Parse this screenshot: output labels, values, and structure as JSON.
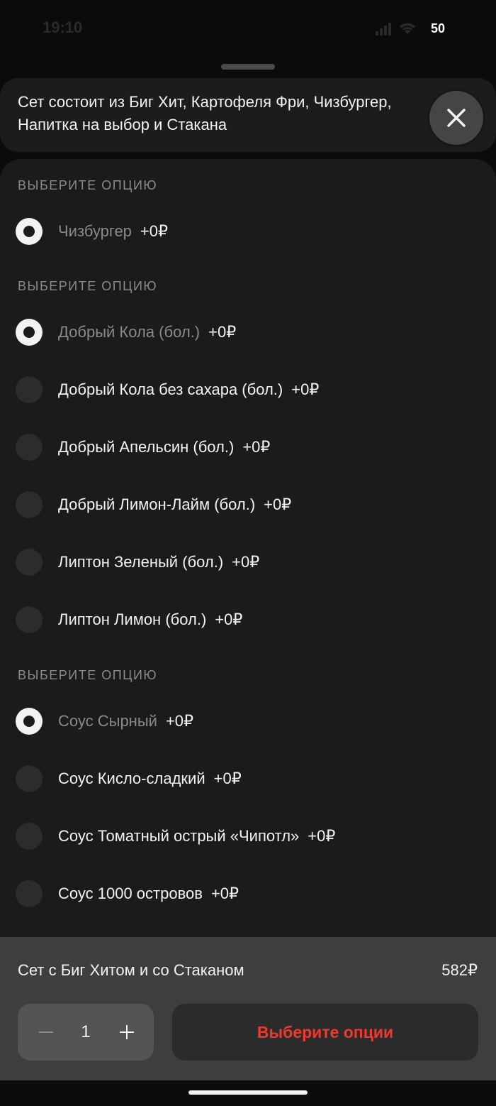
{
  "status_bar": {
    "time": "19:10",
    "battery": "50"
  },
  "header": {
    "description_line1": "Сет состоит из Биг Хит, Картофеля Фри, Чизбургер,",
    "description_line2": "Напитка на выбор и Стакана"
  },
  "icons": {
    "close": "close-icon",
    "minus": "minus-icon",
    "plus": "plus-icon"
  },
  "sections": [
    {
      "title": "ВЫБЕРИТЕ ОПЦИЮ",
      "options": [
        {
          "name": "Чизбургер",
          "price": "+0₽",
          "selected": true
        }
      ]
    },
    {
      "title": "ВЫБЕРИТЕ ОПЦИЮ",
      "options": [
        {
          "name": "Добрый Кола (бол.)",
          "price": "+0₽",
          "selected": true
        },
        {
          "name": "Добрый Кола без сахара (бол.)",
          "price": "+0₽",
          "selected": false
        },
        {
          "name": "Добрый Апельсин (бол.)",
          "price": "+0₽",
          "selected": false
        },
        {
          "name": "Добрый Лимон-Лайм (бол.)",
          "price": "+0₽",
          "selected": false
        },
        {
          "name": "Липтон Зеленый (бол.)",
          "price": "+0₽",
          "selected": false
        },
        {
          "name": "Липтон Лимон (бол.)",
          "price": "+0₽",
          "selected": false
        }
      ]
    },
    {
      "title": "ВЫБЕРИТЕ ОПЦИЮ",
      "options": [
        {
          "name": "Соус Сырный",
          "price": "+0₽",
          "selected": true
        },
        {
          "name": "Соус Кисло-сладкий",
          "price": "+0₽",
          "selected": false
        },
        {
          "name": "Соус Томатный острый «Чипотл»",
          "price": "+0₽",
          "selected": false
        },
        {
          "name": "Соус 1000 островов",
          "price": "+0₽",
          "selected": false
        }
      ]
    }
  ],
  "footer": {
    "product_title": "Сет с Биг Хитом и со Стаканом",
    "price": "582₽",
    "quantity": "1",
    "cta_label": "Выберите опции"
  },
  "colors": {
    "accent": "#ee3a2e",
    "panel": "#1b1b1b",
    "footer": "#3e3e3c"
  }
}
